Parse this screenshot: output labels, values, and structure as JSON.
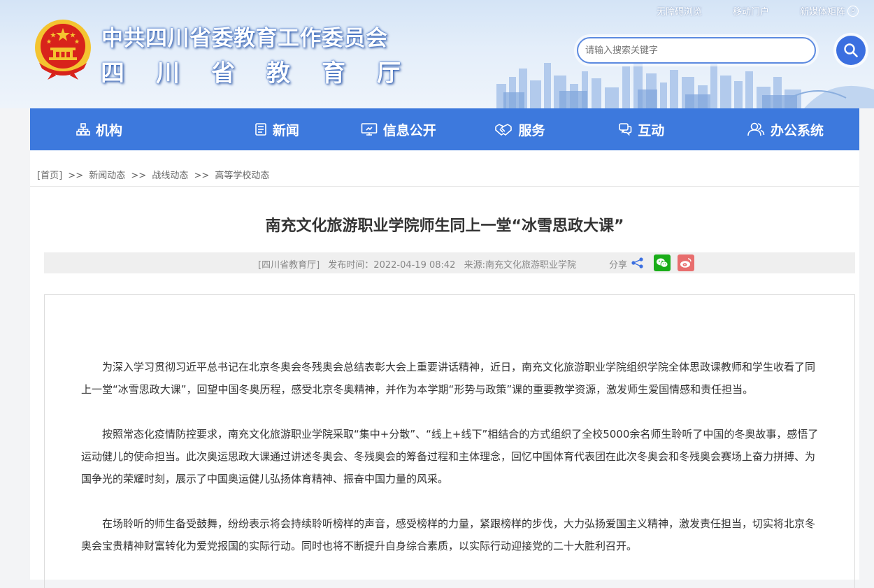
{
  "toplinks": {
    "accessible": "无障碍浏览",
    "mobile": "移动门户",
    "media": "新媒体矩阵"
  },
  "header": {
    "title_line1": "中共四川省委教育工作委员会",
    "title_line2": "四川省教育厅"
  },
  "search": {
    "placeholder": "请输入搜索关键字"
  },
  "nav": [
    {
      "label": "机构",
      "icon": "org-chart-icon"
    },
    {
      "label": "新闻",
      "icon": "newspaper-icon"
    },
    {
      "label": "信息公开",
      "icon": "monitor-icon"
    },
    {
      "label": "服务",
      "icon": "handshake-icon"
    },
    {
      "label": "互动",
      "icon": "chat-icon"
    },
    {
      "label": "办公系统",
      "icon": "users-icon"
    }
  ],
  "breadcrumb": {
    "home": "[首页]",
    "sep": ">>",
    "items": [
      "新闻动态",
      "战线动态",
      "高等学校动态"
    ]
  },
  "article": {
    "title": "南充文化旅游职业学院师生同上一堂“冰雪思政大课”",
    "source_tag": "[四川省教育厅]",
    "publish_time": "发布时间：2022-04-19 08:42",
    "origin": "来源:南充文化旅游职业学院",
    "share_label": "分享",
    "paragraphs": [
      "为深入学习贯彻习近平总书记在北京冬奥会冬残奥会总结表彰大会上重要讲话精神，近日，南充文化旅游职业学院组织学院全体思政课教师和学生收看了同上一堂“冰雪思政大课”，回望中国冬奥历程，感受北京冬奥精神，并作为本学期“形势与政策”课的重要教学资源，激发师生爱国情感和责任担当。",
      "按照常态化疫情防控要求，南充文化旅游职业学院采取“集中+分散”、“线上+线下”相结合的方式组织了全校5000余名师生聆听了中国的冬奥故事，感悟了运动健儿的使命担当。此次奥运思政大课通过讲述冬奥会、冬残奥会的筹备过程和主体理念，回忆中国体育代表团在此次冬奥会和冬残奥会赛场上奋力拼搏、为国争光的荣耀时刻，展示了中国奥运健儿弘扬体育精神、振奋中国力量的风采。",
      "在场聆听的师生备受鼓舞，纷纷表示将会持续聆听榜样的声音，感受榜样的力量，紧跟榜样的步伐，大力弘扬爱国主义精神，激发责任担当，切实将北京冬奥会宝贵精神财富转化为爱党报国的实际行动。同时也将不断提升自身综合素质，以实际行动迎接党的二十大胜利召开。"
    ]
  },
  "colors": {
    "nav_bg": "#3d79dd",
    "search_btn": "#3b6fe0",
    "wechat": "#1aad19",
    "weibo": "#e86d6d",
    "emblem_red": "#d8231b",
    "emblem_gold": "#f4c430"
  }
}
